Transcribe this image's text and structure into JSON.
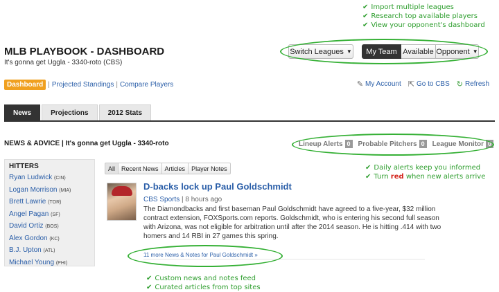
{
  "callouts": {
    "top": [
      "Import multiple leagues",
      "Research top available players",
      "View your opponent's dashboard"
    ],
    "alerts_1": "Daily alerts keep you informed",
    "alerts_2_before": "Turn",
    "alerts_2_red": "red",
    "alerts_2_after": "when new alerts arrive",
    "bottom": [
      "Custom news and notes feed",
      "Curated articles from top sites"
    ],
    "check_glyph": "✔",
    "callout_color": "#2e9e2e",
    "oval_color": "#35b035"
  },
  "header": {
    "title": "MLB PLAYBOOK - DASHBOARD",
    "subtitle": "It's gonna get Uggla - 3340-roto (CBS)",
    "switch_leagues": "Switch Leagues",
    "segments": [
      "My Team",
      "Available",
      "Opponent"
    ],
    "caret": "▼"
  },
  "nav": {
    "dashboard": "Dashboard",
    "sep": "|",
    "projected_standings": "Projected Standings",
    "compare_players": "Compare Players",
    "dashboard_color": "#f0a020"
  },
  "tools": {
    "my_account": "My Account",
    "go_to_cbs": "Go to CBS",
    "refresh": "Refresh",
    "icons": [
      "edit-icon",
      "export-icon",
      "refresh-icon"
    ]
  },
  "tabs": [
    "News",
    "Projections",
    "2012 Stats"
  ],
  "news": {
    "heading": "NEWS & ADVICE | It's gonna get Uggla - 3340-roto",
    "alerts": [
      {
        "label": "Lineup Alerts",
        "count": "0"
      },
      {
        "label": "Probable Pitchers",
        "count": "0"
      },
      {
        "label": "League Monitor",
        "count": "0"
      }
    ]
  },
  "hitters": {
    "title": "HITTERS",
    "players": [
      {
        "name": "Ryan Ludwick",
        "team": "(CIN)"
      },
      {
        "name": "Logan Morrison",
        "team": "(MIA)"
      },
      {
        "name": "Brett Lawrie",
        "team": "(TOR)"
      },
      {
        "name": "Angel Pagan",
        "team": "(SF)"
      },
      {
        "name": "David Ortiz",
        "team": "(BOS)"
      },
      {
        "name": "Alex Gordon",
        "team": "(KC)"
      },
      {
        "name": "B.J. Upton",
        "team": "(ATL)"
      },
      {
        "name": "Michael Young",
        "team": "(PHI)"
      }
    ]
  },
  "filters": [
    "All",
    "Recent News",
    "Articles",
    "Player Notes"
  ],
  "story": {
    "title": "D-backs lock up Paul Goldschmidt",
    "source": "CBS Sports",
    "meta_sep": " | ",
    "time": "8 hours ago",
    "body": "The Diamondbacks and first baseman Paul Goldschmidt have agreed to a five-year, $32 million contract extension, FOXSports.com reports. Goldschmidt, who is entering his second full season with Arizona, was not eligible for arbitration until after the 2014 season. He is hitting .414 with two homers and 14 RBI in 27 games this spring.",
    "more_link": "11 more News & Notes for Paul Goldschmidt »"
  }
}
